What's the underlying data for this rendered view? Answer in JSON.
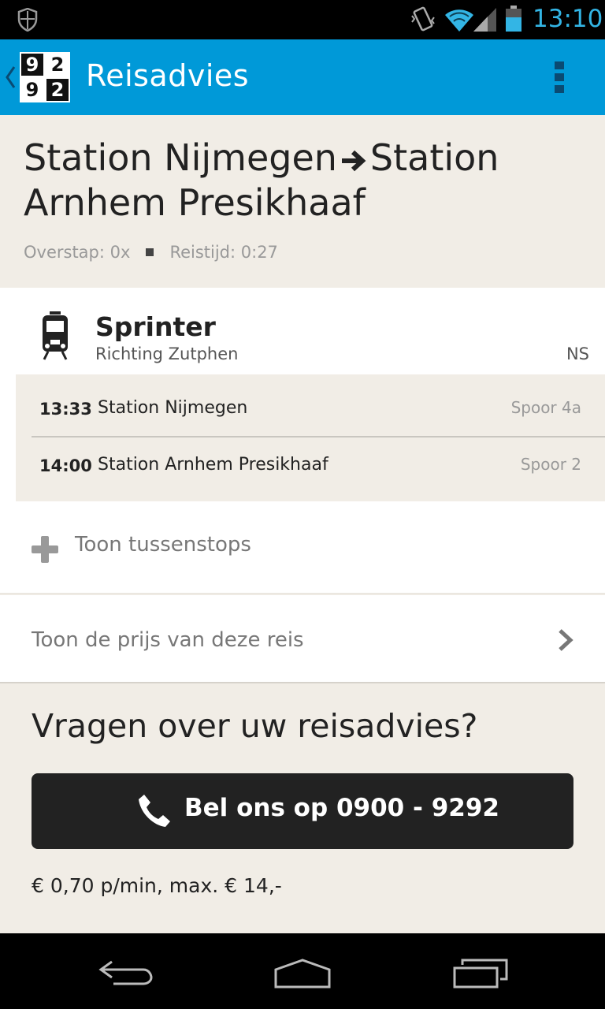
{
  "status_bar": {
    "time": "13:10",
    "accent_color": "#33b5e5",
    "icons": [
      "shield-icon",
      "vibrate-icon",
      "wifi-icon",
      "signal-icon",
      "battery-icon"
    ]
  },
  "action_bar": {
    "title": "Reisadvies",
    "logo": [
      "9",
      "2",
      "9",
      "2"
    ],
    "color": "#0099d8"
  },
  "route": {
    "from": "Station Nijmegen",
    "to": "Station Arnhem Presikhaaf",
    "transfers": "Overstap: 0x",
    "travel_time": "Reistijd: 0:27"
  },
  "leg": {
    "mode": "Sprinter",
    "direction": "Richting Zutphen",
    "operator": "NS",
    "stops": [
      {
        "time": "13:33",
        "name": "Station Nijmegen",
        "platform": "Spoor 4a"
      },
      {
        "time": "14:00",
        "name": "Station Arnhem Presikhaaf",
        "platform": "Spoor 2"
      }
    ],
    "show_stops_label": "Toon tussenstops"
  },
  "price": {
    "label": "Toon de prijs van deze reis"
  },
  "questions": {
    "heading": "Vragen over uw reisadvies?",
    "call_label": "Bel ons op 0900 - 9292",
    "rate": "€ 0,70 p/min, max. € 14,-"
  }
}
